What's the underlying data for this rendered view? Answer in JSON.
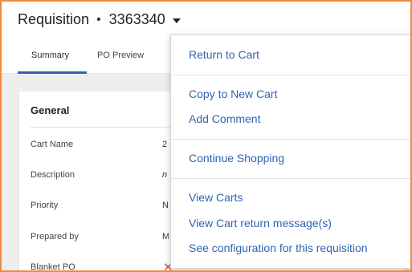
{
  "header": {
    "title": "Requisition",
    "separator": "•",
    "number": "3363340",
    "dropdown_icon": "caret-down-icon"
  },
  "tabs": [
    {
      "label": "Summary",
      "active": true
    },
    {
      "label": "PO Preview",
      "active": false
    }
  ],
  "card": {
    "title": "General",
    "rows": [
      {
        "label": "Cart Name",
        "value": "2"
      },
      {
        "label": "Description",
        "value": "n"
      },
      {
        "label": "Priority",
        "value": "N"
      },
      {
        "label": "Prepared by",
        "value": "M"
      },
      {
        "label": "Blanket PO",
        "value_icon": "x-icon"
      }
    ]
  },
  "menu": {
    "items": [
      {
        "label": "Return to Cart"
      },
      {
        "label": "Copy to New Cart"
      },
      {
        "label": "Add Comment"
      },
      {
        "label": "Continue Shopping"
      },
      {
        "label": "View Carts"
      },
      {
        "label": "View Cart return message(s)"
      },
      {
        "label": "See configuration for this requisition"
      }
    ]
  },
  "colors": {
    "frame_border": "#f08a3a",
    "link": "#2f64b4",
    "tab_underline": "#2f64b4",
    "x_mark": "#d8453a"
  }
}
